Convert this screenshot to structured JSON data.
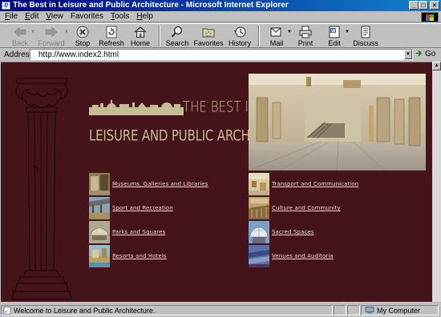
{
  "window": {
    "title": "The Best in Leisure and Public Architecture - Microsoft Internet Explorer",
    "controls": [
      "_",
      "□",
      "×"
    ]
  },
  "menu": [
    {
      "label": "File",
      "key": "F",
      "rest": "ile"
    },
    {
      "label": "Edit",
      "key": "E",
      "rest": "dit"
    },
    {
      "label": "View",
      "key": "V",
      "rest": "iew"
    },
    {
      "label": "Favorites",
      "key": "F",
      "rest": "avorites"
    },
    {
      "label": "Tools",
      "key": "T",
      "rest": "ools"
    },
    {
      "label": "Help",
      "key": "H",
      "rest": "elp"
    }
  ],
  "toolbar": {
    "back": "Back",
    "forward": "Forward",
    "stop": "Stop",
    "refresh": "Refresh",
    "home": "Home",
    "search": "Search",
    "favorites": "Favorites",
    "history": "History",
    "mail": "Mail",
    "print": "Print",
    "edit": "Edit",
    "discuss": "Discuss"
  },
  "address": {
    "label": "Address",
    "url": "http://www.index2.html",
    "go": "Go"
  },
  "page": {
    "title_line1": "THE BEST IN",
    "title_line2": "LEISURE AND PUBLIC ARCHITECTURE",
    "colors": {
      "background": "#45141b",
      "title": "#c5bc96",
      "link": "#e8dcc8"
    },
    "links_left": [
      "Museums, Galleries and Libraries",
      "Sport and Recreation",
      "Parks and Squares",
      "Resorts and Hotels"
    ],
    "links_right": [
      "Transport and Communication",
      "Culture and Community",
      "Sacred Spaces",
      "Venues and Auditoria"
    ]
  },
  "status": {
    "message": "Welcome to Leisure and Public Architecture.",
    "zone": "My Computer"
  }
}
